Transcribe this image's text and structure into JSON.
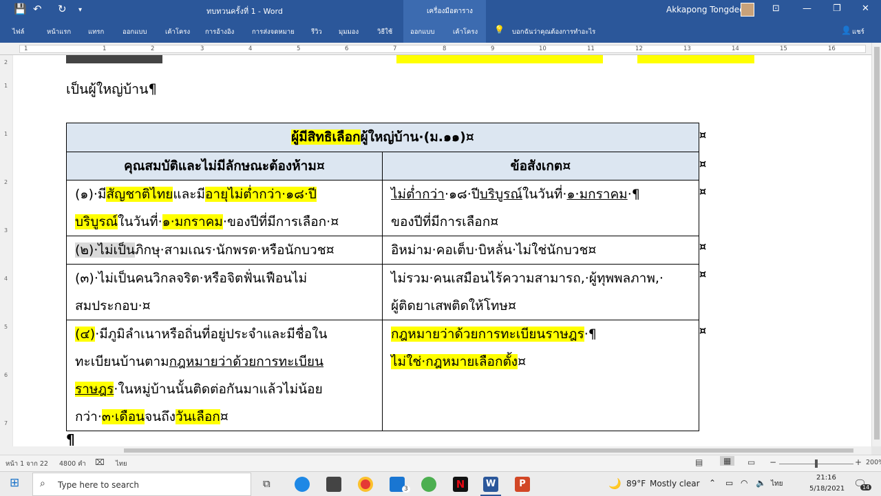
{
  "titlebar": {
    "doc_title": "ทบทวนครั้งที่ 1  -  Word",
    "context_title": "เครื่องมือตาราง",
    "user_name": "Akkapong Tongdee"
  },
  "ribbon": {
    "tabs": [
      "ไฟล์",
      "หน้าแรก",
      "แทรก",
      "ออกแบบ",
      "เค้าโครง",
      "การอ้างอิง",
      "การส่งจดหมาย",
      "รีวิว",
      "มุมมอง",
      "วิธีใช้",
      "ออกแบบ",
      "เค้าโครง"
    ],
    "tell_me": "บอกฉันว่าคุณต้องการทำอะไร",
    "share": "แชร์"
  },
  "ruler": {
    "numbers": [
      "1",
      "1",
      "2",
      "3",
      "4",
      "5",
      "6",
      "7",
      "8",
      "9",
      "10",
      "11",
      "12",
      "13",
      "14",
      "15",
      "16"
    ]
  },
  "vruler": {
    "numbers": [
      "2",
      "1",
      "1",
      "2",
      "3",
      "4",
      "5",
      "6",
      "7",
      "8"
    ]
  },
  "doc": {
    "line_before": "เป็นผู้ใหญ่บ้าน¶",
    "table_title_hl": "ผู้มีสิทธิเลือก",
    "table_title_rest": "ผู้ใหญ่บ้าน·(ม.๑๑)¤",
    "col1_header": "คุณสมบัติและไม่มีลักษณะต้องห้าม¤",
    "col2_header": "ข้อสังเกต¤",
    "cell_mark": "¤",
    "rows": [
      {
        "left": [
          {
            "t": "(๑)·มี",
            "s": ""
          },
          {
            "t": "สัญชาติไทย",
            "s": "hl"
          },
          {
            "t": "และมี",
            "s": ""
          },
          {
            "t": "อายุไม่ต่ำกว่า·๑๘·ปี",
            "s": "hl"
          },
          {
            "t": "BR",
            "s": "br"
          },
          {
            "t": "บริบูรณ์",
            "s": "hl"
          },
          {
            "t": "ในวันที่·",
            "s": ""
          },
          {
            "t": "๑·มกราคม",
            "s": "hl"
          },
          {
            "t": "·ของปีที่มีการเลือก·¤",
            "s": ""
          }
        ],
        "right": [
          {
            "t": "ไม่ต่ำกว่า",
            "s": "ul"
          },
          {
            "t": "·๑๘·ปี",
            "s": ""
          },
          {
            "t": "บริบูรณ์",
            "s": "ul"
          },
          {
            "t": "ในวันที่·",
            "s": ""
          },
          {
            "t": "๑·มกราคม",
            "s": "ul"
          },
          {
            "t": "·¶",
            "s": ""
          },
          {
            "t": "BR",
            "s": "br"
          },
          {
            "t": "ของปีที่มีการเลือก¤",
            "s": ""
          }
        ]
      },
      {
        "left": [
          {
            "t": "(๒)·ไม่เป็น",
            "s": "sel"
          },
          {
            "t": "ภิกษุ·สามเณร·นักพรต·หรือนักบวช¤",
            "s": ""
          }
        ],
        "right": [
          {
            "t": "อิหม่าม·คอเต็บ·บิหลั่น·ไม่ใช่นักบวช¤",
            "s": ""
          }
        ]
      },
      {
        "left": [
          {
            "t": "(๓)·ไม่เป็นคนวิกลจริต·หรือจิตฟั่นเฟือนไม่",
            "s": ""
          },
          {
            "t": "BR",
            "s": "br"
          },
          {
            "t": "สมประกอบ·¤",
            "s": ""
          }
        ],
        "right": [
          {
            "t": "ไม่รวม·คนเสมือนไร้ความสามารถ,·ผู้ทุพพลภาพ,·",
            "s": ""
          },
          {
            "t": "BR",
            "s": "br"
          },
          {
            "t": "ผู้ติดยาเสพติดให้โทษ¤",
            "s": ""
          }
        ]
      },
      {
        "left": [
          {
            "t": "(๔)",
            "s": "hl"
          },
          {
            "t": "·มีภูมิลำเนาหรือถิ่นที่อยู่ประจำและมีชื่อใน",
            "s": ""
          },
          {
            "t": "BR",
            "s": "br"
          },
          {
            "t": "ทะเบียนบ้านตาม",
            "s": ""
          },
          {
            "t": "กฎหมายว่าด้วยการทะเบียน",
            "s": "ul"
          },
          {
            "t": "BR",
            "s": "br"
          },
          {
            "t": "ราษฎร",
            "s": "hlul"
          },
          {
            "t": "·ในหมู่บ้านนั้นติดต่อกันมาแล้วไม่น้อย",
            "s": ""
          },
          {
            "t": "BR",
            "s": "br"
          },
          {
            "t": "กว่า·",
            "s": ""
          },
          {
            "t": "๓·เดือน",
            "s": "hl"
          },
          {
            "t": "จนถึง",
            "s": ""
          },
          {
            "t": "วันเลือก",
            "s": "hl"
          },
          {
            "t": "¤",
            "s": ""
          }
        ],
        "right": [
          {
            "t": "กฎหมายว่าด้วยการทะเบียนราษฎร",
            "s": "hl"
          },
          {
            "t": "·¶",
            "s": ""
          },
          {
            "t": "BR",
            "s": "br"
          },
          {
            "t": "ไม่ใช่·กฎหมายเลือกตั้ง",
            "s": "hl"
          },
          {
            "t": "¤",
            "s": ""
          }
        ]
      }
    ],
    "pilcrow": "¶"
  },
  "status": {
    "page": "หน้า 1 จาก 22",
    "words": "4800 คำ",
    "lang": "ไทย",
    "zoom": "200%"
  },
  "taskbar": {
    "search_placeholder": "Type here to search",
    "weather_temp": "89°F",
    "weather_text": "Mostly clear",
    "ime": "ไทย",
    "time": "21:16",
    "date": "5/18/2021",
    "notif_count": "14",
    "mail_badge": "3"
  },
  "colors": {
    "word_blue": "#2b579a",
    "context_blue": "#3c6bb0",
    "highlight": "#ffff00",
    "table_header": "#dce6f1"
  }
}
